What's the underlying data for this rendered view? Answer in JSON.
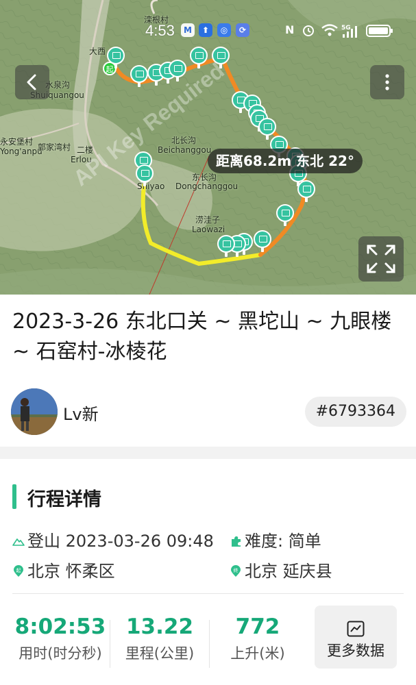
{
  "status_bar": {
    "time": "4:53",
    "apps": [
      "M",
      "⬆",
      "◎",
      "⟳"
    ],
    "right_icons": [
      "N",
      "⏰",
      "wifi",
      "5G"
    ]
  },
  "map": {
    "labels": [
      {
        "text": "水泉沟"
      },
      {
        "text": "Shuiquangou"
      },
      {
        "text": "永安堡村"
      },
      {
        "text": "Yong'anpu"
      },
      {
        "text": "郭家湾村"
      },
      {
        "text": "二楼"
      },
      {
        "text": "Erlou"
      },
      {
        "text": "北长沟"
      },
      {
        "text": "Beichanggou"
      },
      {
        "text": "东长沟"
      },
      {
        "text": "Dongchanggou"
      },
      {
        "text": "涝洼子"
      },
      {
        "text": "Laowazi"
      },
      {
        "text": "Shiyao"
      },
      {
        "text": "大西"
      },
      {
        "text": "滦根村"
      }
    ],
    "watermark": "API Key Required",
    "distance_label": "距离68.2",
    "distance_label_rest": "m 东北 22°",
    "start_badge": "起"
  },
  "title": "2023-3-26 东北口关 ~ 黑坨山 ~ 九眼楼 ~ 石窑村-冰棱花",
  "author": {
    "name": "Lv新",
    "trip_id": "#6793364"
  },
  "details": {
    "section_title": "行程详情",
    "activity_time": "登山 2023-03-26 09:48",
    "difficulty": "难度:  简单",
    "start": "北京 怀柔区",
    "end": "北京 延庆县",
    "start_badge": "起",
    "end_badge": "终"
  },
  "stats": [
    {
      "value": "8:02:53",
      "label": "用时(时分秒)"
    },
    {
      "value": "13.22",
      "label": "里程(公里)"
    },
    {
      "value": "772",
      "label": "上升(米)"
    }
  ],
  "more_data_label": "更多数据",
  "colors": {
    "accent": "#2fbf8c",
    "stat_value": "#16a878",
    "route_orange": "#f08a24",
    "route_yellow": "#f2ec2a",
    "pin": "#36c3a0"
  }
}
